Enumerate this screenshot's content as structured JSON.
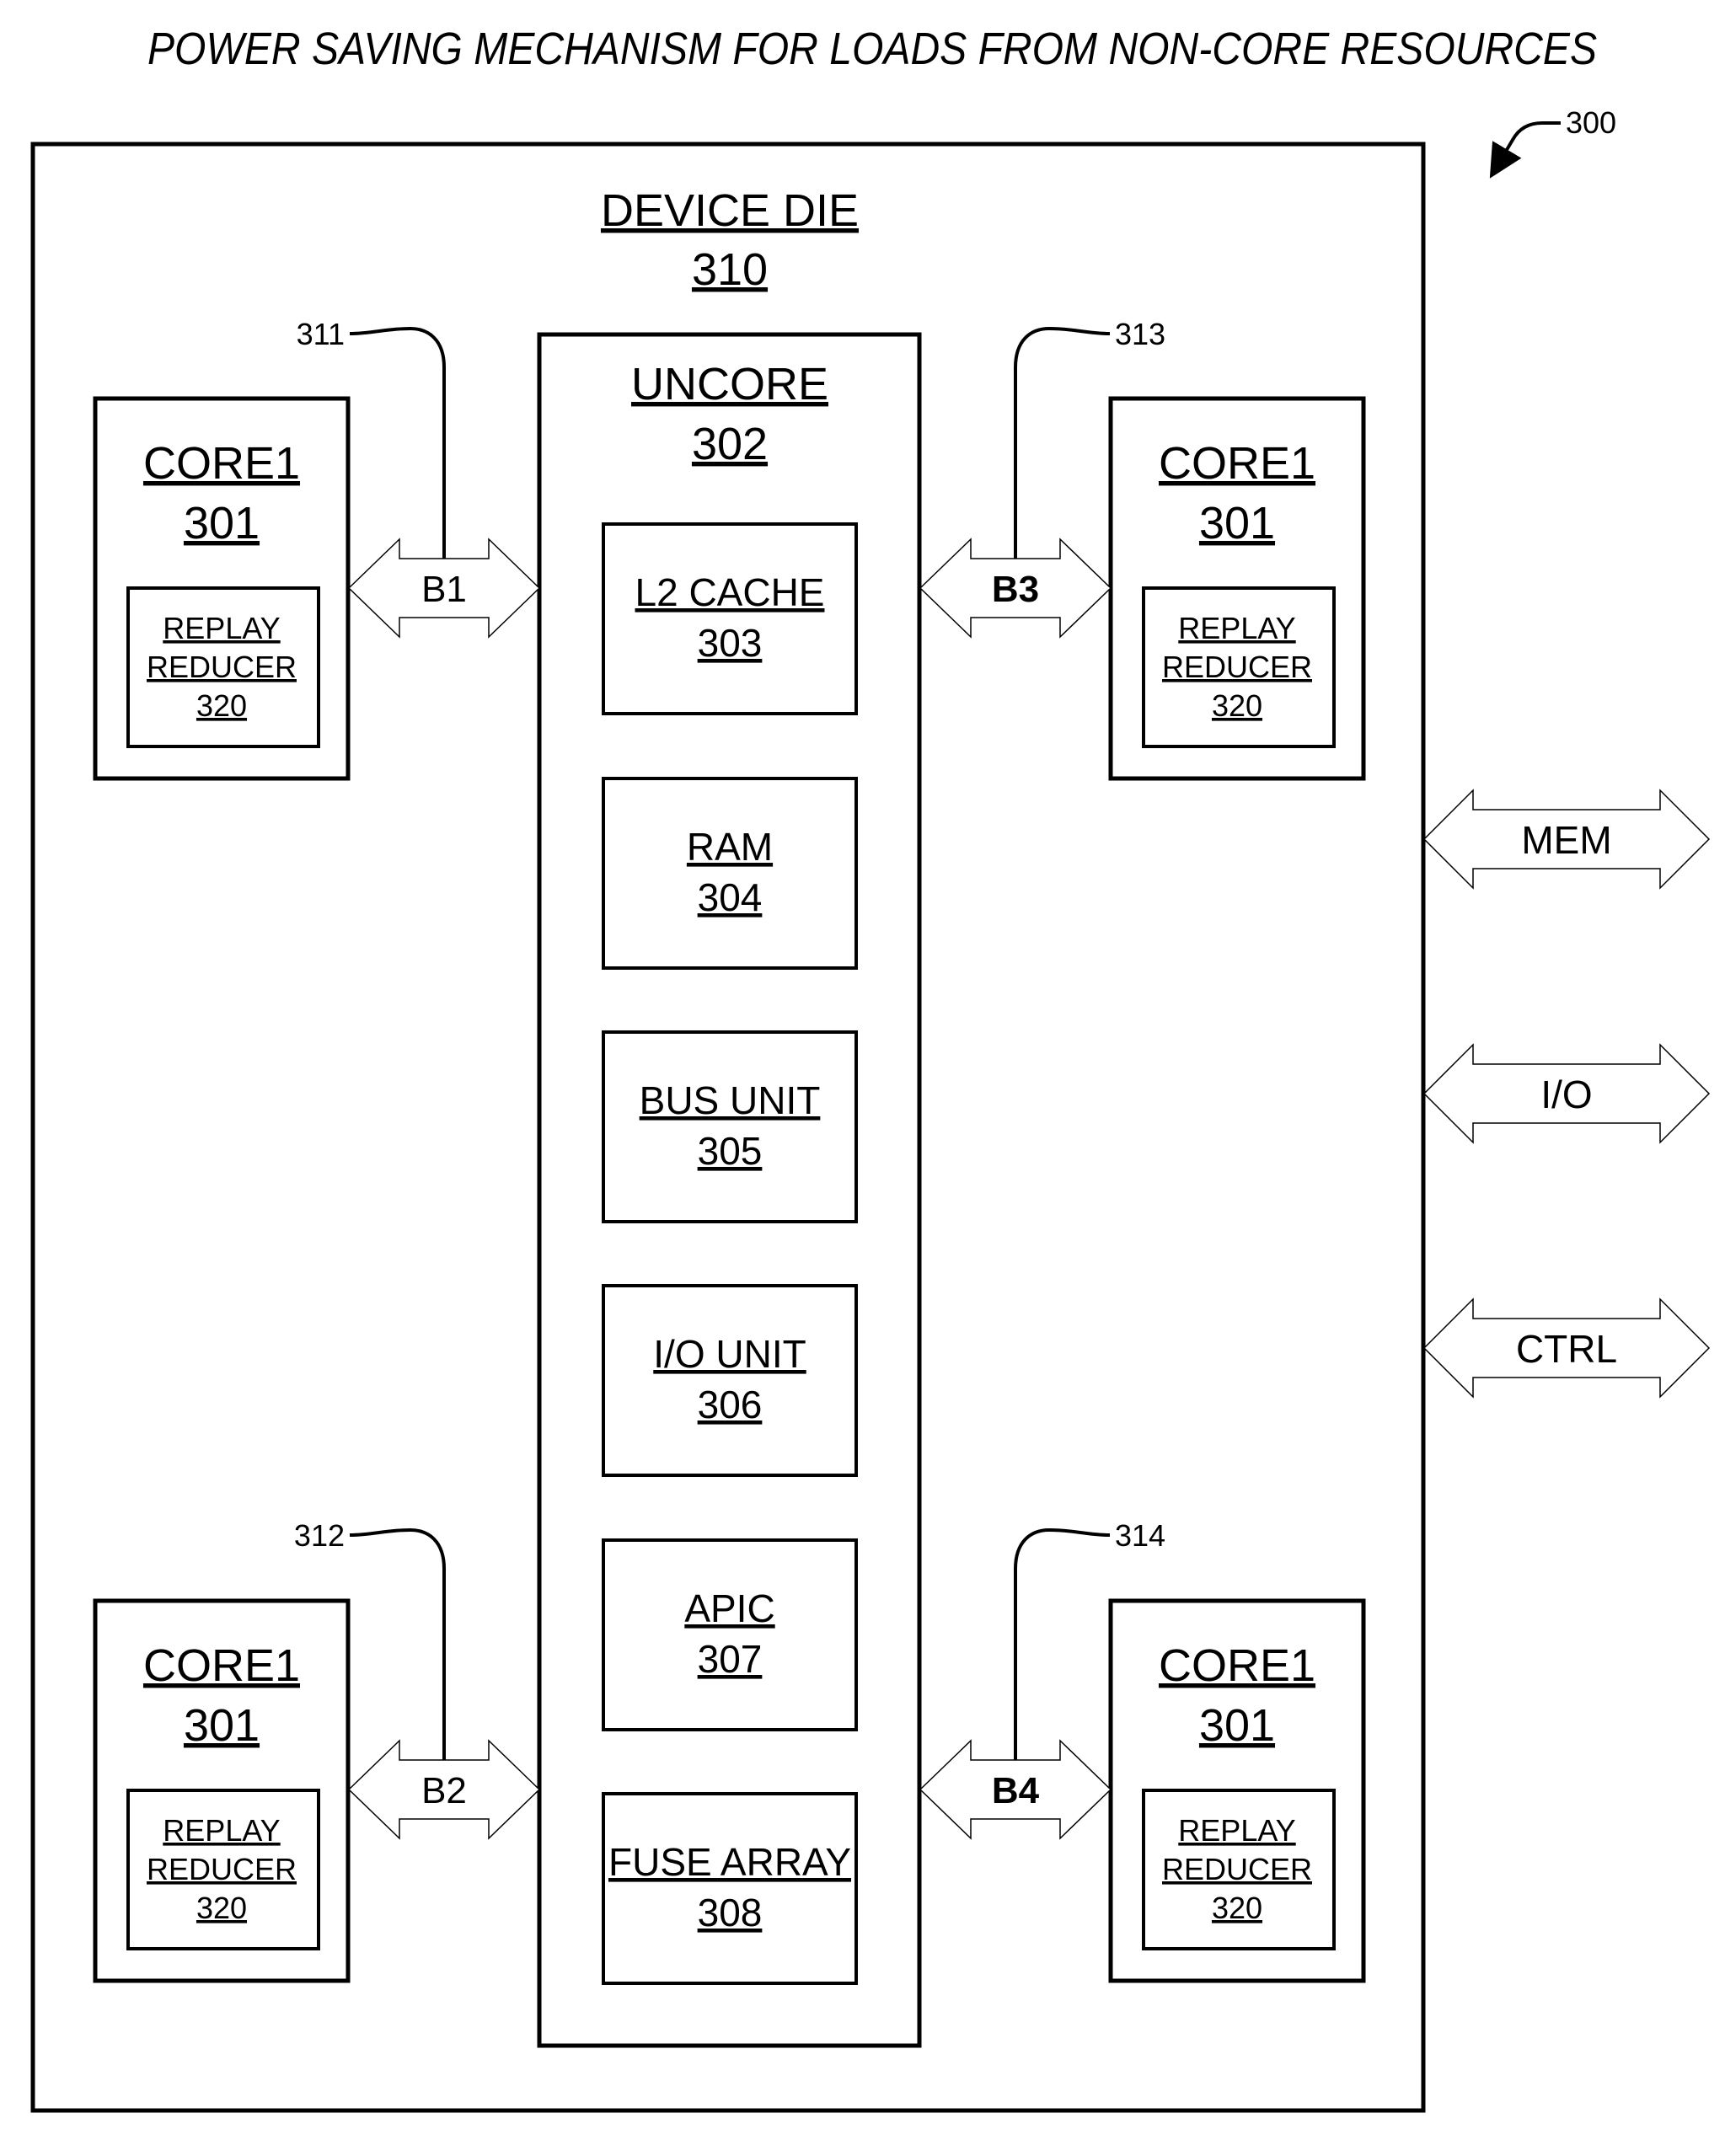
{
  "figure": {
    "title": "POWER SAVING MECHANISM FOR LOADS FROM NON-CORE RESOURCES",
    "figure_ref": "300"
  },
  "device_die": {
    "label": "DEVICE DIE",
    "ref": "310"
  },
  "uncore": {
    "label": "UNCORE",
    "ref": "302",
    "units": [
      {
        "label": "L2 CACHE",
        "ref": "303"
      },
      {
        "label": "RAM",
        "ref": "304"
      },
      {
        "label": "BUS UNIT",
        "ref": "305"
      },
      {
        "label": "I/O UNIT",
        "ref": "306"
      },
      {
        "label": "APIC",
        "ref": "307"
      },
      {
        "label": "FUSE ARRAY",
        "ref": "308"
      }
    ]
  },
  "cores": [
    {
      "label": "CORE1",
      "ref": "301",
      "reducer": {
        "line1": "REPLAY",
        "line2": "REDUCER",
        "ref": "320"
      }
    },
    {
      "label": "CORE1",
      "ref": "301",
      "reducer": {
        "line1": "REPLAY",
        "line2": "REDUCER",
        "ref": "320"
      }
    },
    {
      "label": "CORE1",
      "ref": "301",
      "reducer": {
        "line1": "REPLAY",
        "line2": "REDUCER",
        "ref": "320"
      }
    },
    {
      "label": "CORE1",
      "ref": "301",
      "reducer": {
        "line1": "REPLAY",
        "line2": "REDUCER",
        "ref": "320"
      }
    }
  ],
  "buses": [
    {
      "label": "B1",
      "ref": "311"
    },
    {
      "label": "B2",
      "ref": "312"
    },
    {
      "label": "B3",
      "ref": "313"
    },
    {
      "label": "B4",
      "ref": "314"
    }
  ],
  "external_interfaces": [
    {
      "label": "MEM"
    },
    {
      "label": "I/O"
    },
    {
      "label": "CTRL"
    }
  ]
}
